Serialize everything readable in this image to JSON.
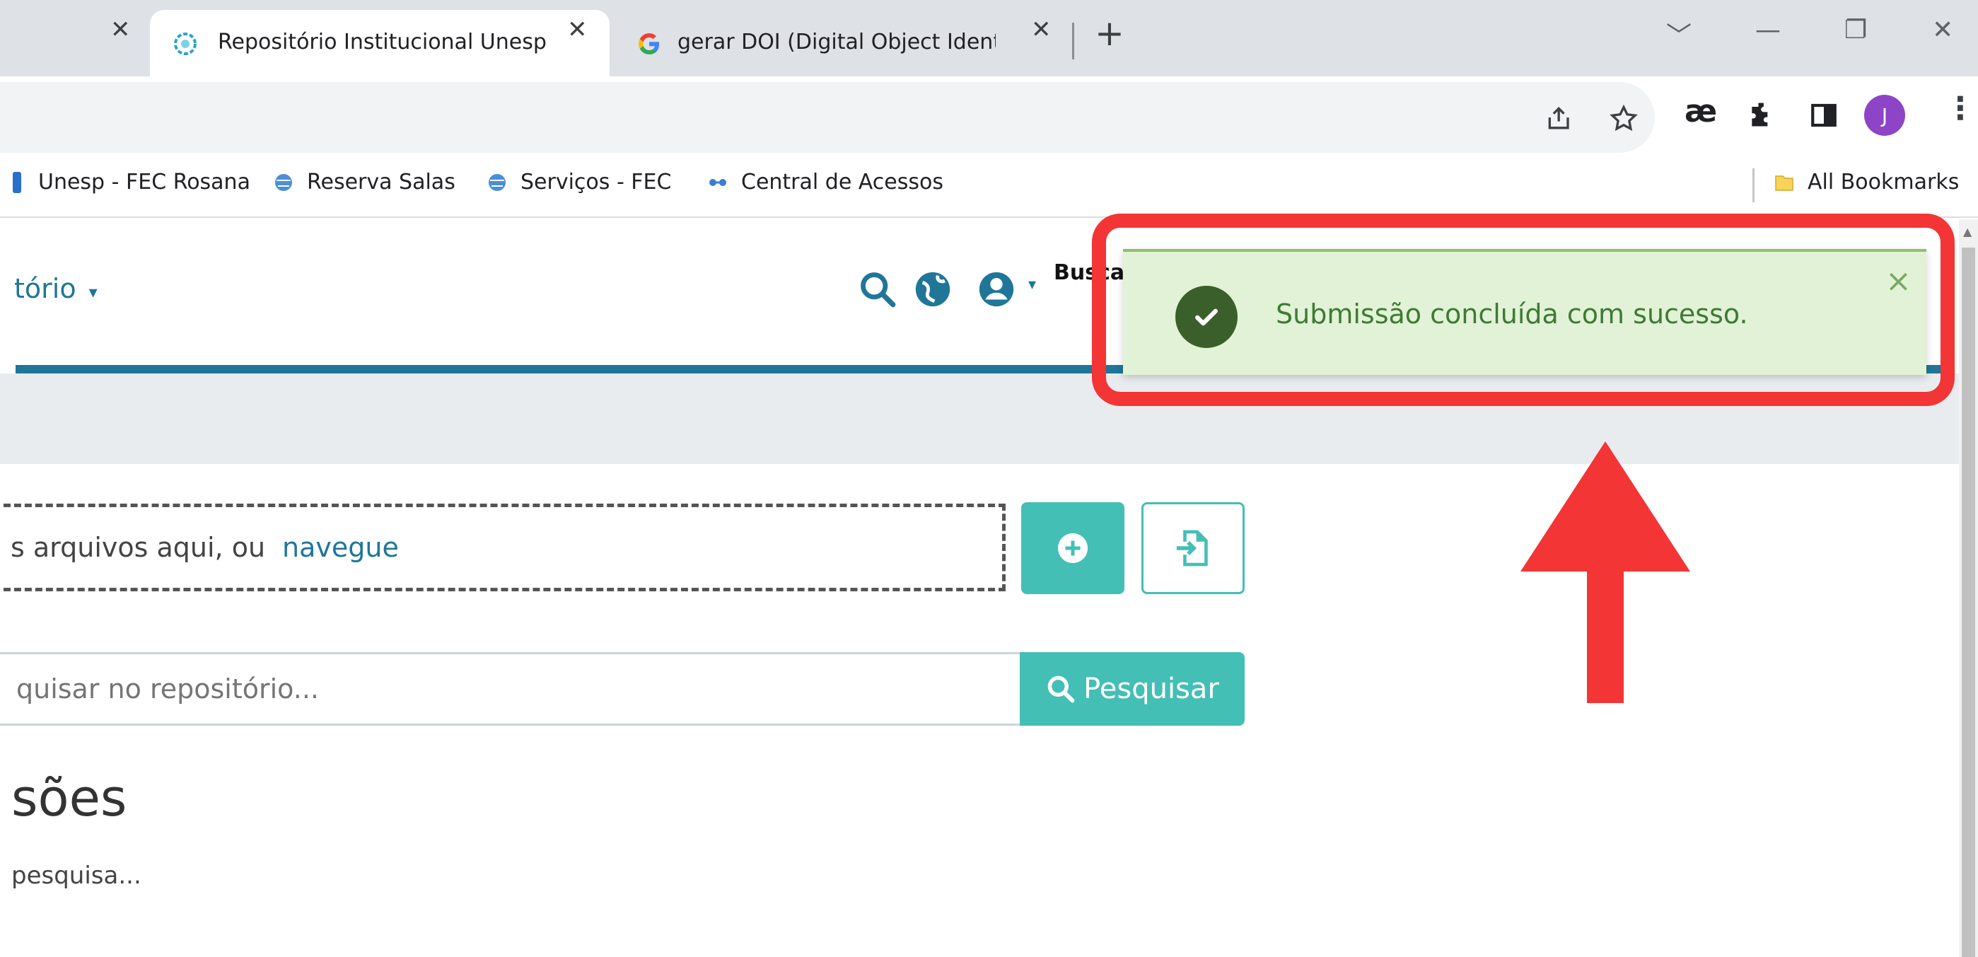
{
  "browser": {
    "tabs": [
      {
        "title": "",
        "active": false
      },
      {
        "title": "Repositório Institucional Unesp",
        "active": true
      },
      {
        "title": "gerar DOI (Digital Object Identif",
        "active": false
      }
    ],
    "new_tab_label": "+",
    "extension_label": "æ",
    "avatar_initial": "J",
    "bookmarks": [
      {
        "label": "Unesp - FEC Rosana"
      },
      {
        "label": "Reserva Salas"
      },
      {
        "label": "Serviços - FEC"
      },
      {
        "label": "Central de Acessos"
      }
    ],
    "all_bookmarks_label": "All Bookmarks"
  },
  "page": {
    "menu_label": "tório",
    "busca_label": "Busca",
    "dropzone_text": "s arquivos aqui, ou",
    "dropzone_link": "navegue",
    "search_placeholder": "quisar no repositório...",
    "search_button": "Pesquisar",
    "heading": "sões",
    "subtext": "pesquisa..."
  },
  "toast": {
    "message": "Submissão concluída com sucesso.",
    "close_label": "×"
  },
  "colors": {
    "accent": "#43bfb5",
    "link": "#207698",
    "toast_bg": "#e1f2d6",
    "annotation": "#f33535"
  }
}
